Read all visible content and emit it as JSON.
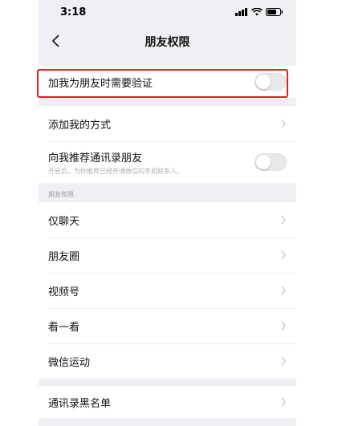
{
  "status_bar": {
    "time": "3:18"
  },
  "nav": {
    "title": "朋友权限"
  },
  "verify_row": {
    "label": "加我为朋友时需要验证",
    "toggle_on": false
  },
  "group2": {
    "add_methods": {
      "label": "添加我的方式"
    },
    "recommend_contacts": {
      "label": "向我推荐通讯录朋友",
      "subtitle": "开启后，为你推荐已经开通微信的手机联系人。",
      "toggle_on": false
    }
  },
  "permissions_section": {
    "header": "朋友权限",
    "items": [
      {
        "label": "仅聊天"
      },
      {
        "label": "朋友圈"
      },
      {
        "label": "视频号"
      },
      {
        "label": "看一看"
      },
      {
        "label": "微信运动"
      }
    ]
  },
  "blacklist": {
    "label": "通讯录黑名单"
  },
  "colors": {
    "highlight": "#e0201f",
    "background": "#efeff4"
  }
}
